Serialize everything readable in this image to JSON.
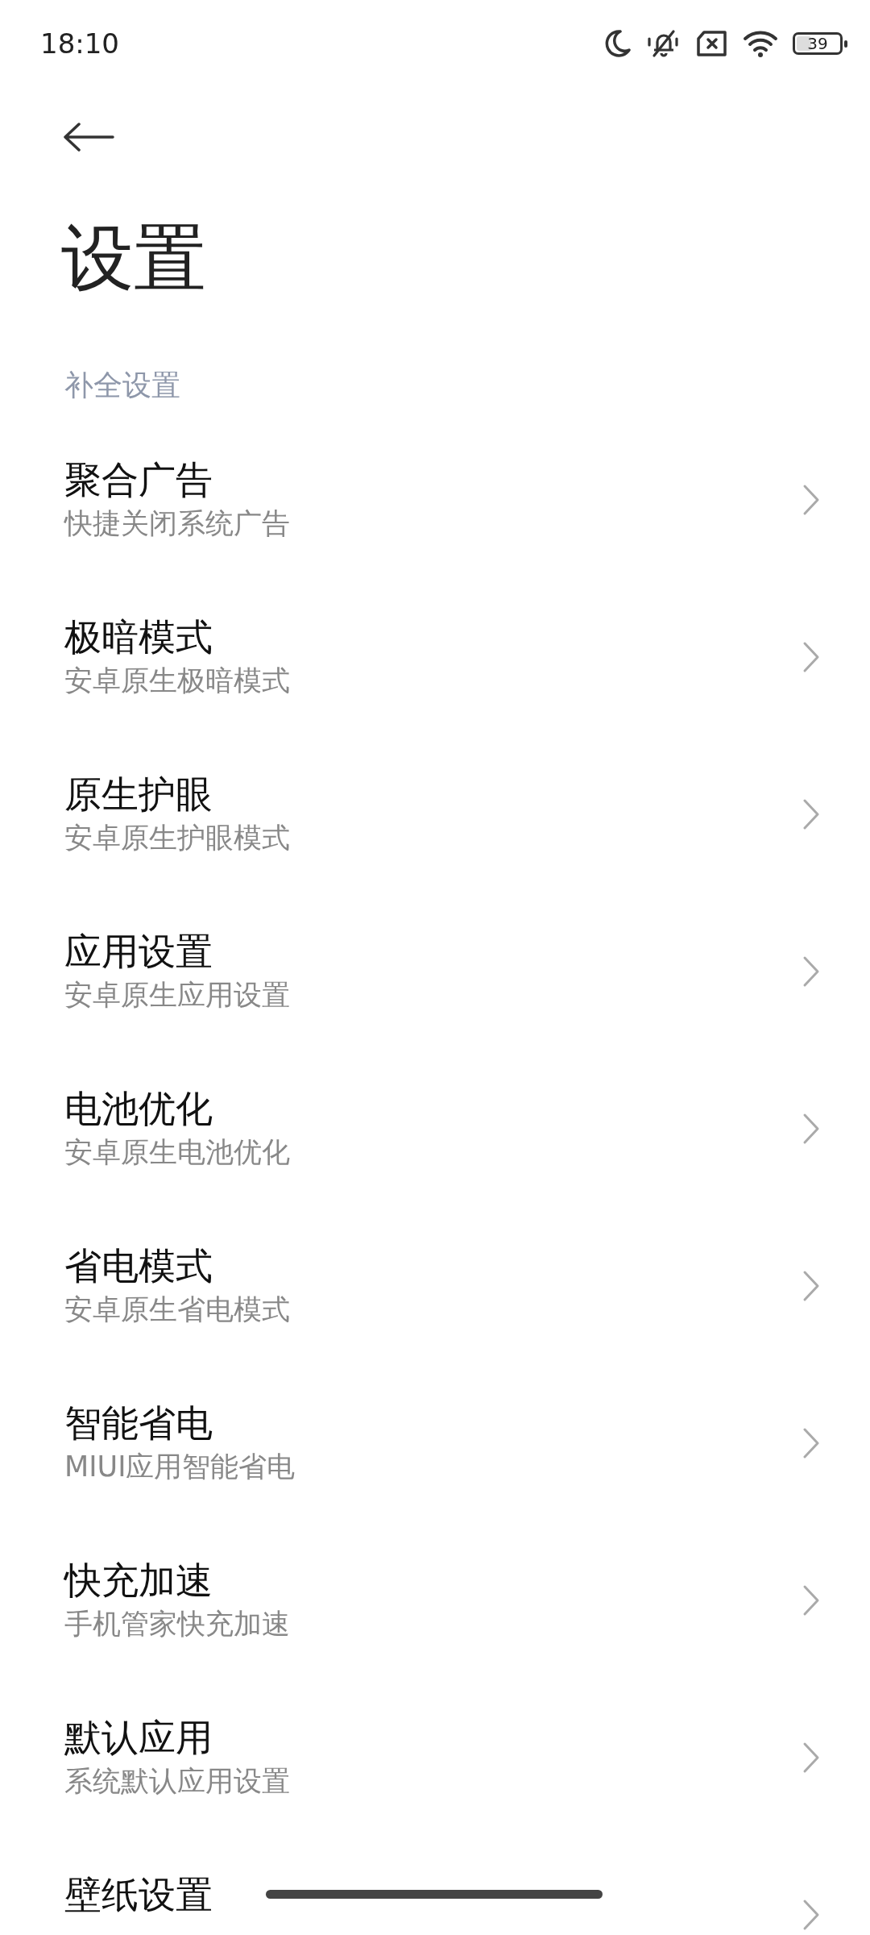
{
  "status_bar": {
    "time": "18:10",
    "battery": {
      "text": "39",
      "level": 0.39
    }
  },
  "title": "设置",
  "section": {
    "header": "补全设置",
    "items": [
      {
        "title": "聚合广告",
        "subtitle": "快捷关闭系统广告"
      },
      {
        "title": "极暗模式",
        "subtitle": "安卓原生极暗模式"
      },
      {
        "title": "原生护眼",
        "subtitle": "安卓原生护眼模式"
      },
      {
        "title": "应用设置",
        "subtitle": "安卓原生应用设置"
      },
      {
        "title": "电池优化",
        "subtitle": "安卓原生电池优化"
      },
      {
        "title": "省电模式",
        "subtitle": "安卓原生省电模式"
      },
      {
        "title": "智能省电",
        "subtitle": "MIUI应用智能省电"
      },
      {
        "title": "快充加速",
        "subtitle": "手机管家快充加速"
      },
      {
        "title": "默认应用",
        "subtitle": "系统默认应用设置"
      },
      {
        "title": "壁纸设置"
      }
    ]
  }
}
